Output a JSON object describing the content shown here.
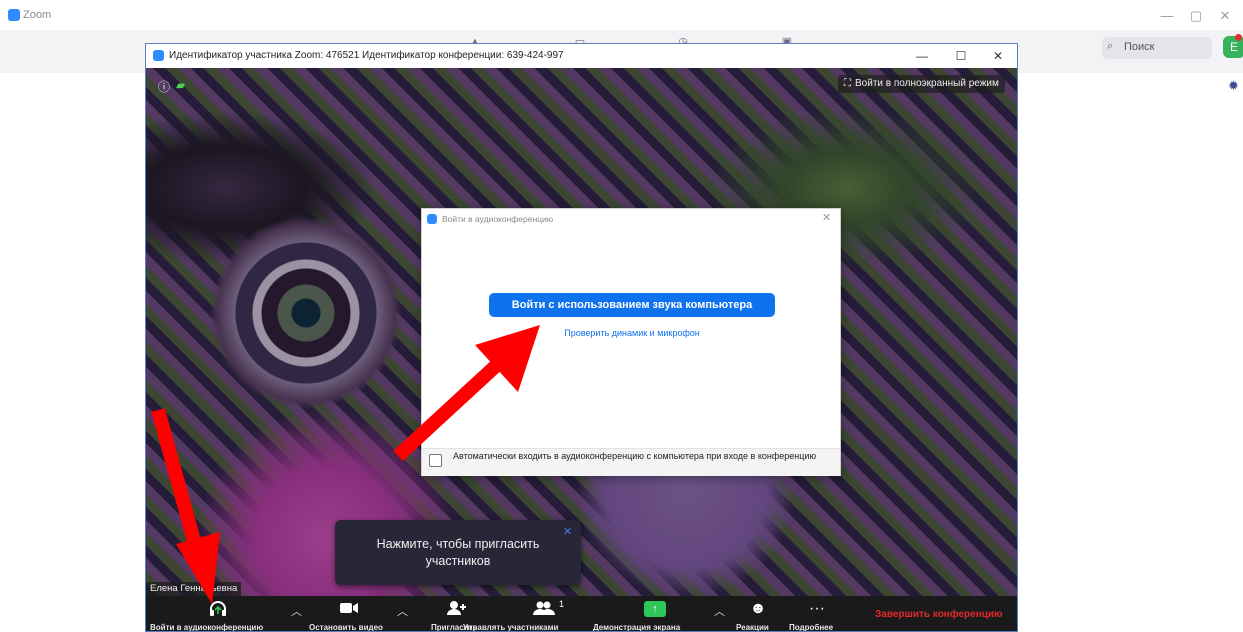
{
  "app": {
    "title": "Zoom",
    "window_controls": {
      "minimize": "—",
      "maximize": "▢",
      "close": "✕"
    },
    "search": {
      "placeholder": "Поиск"
    },
    "profile_initial": "Е"
  },
  "meeting": {
    "window_title": "Идентификатор участника Zoom: 476521   Идентификатор конференции: 639-424-997",
    "window_controls": {
      "minimize": "—",
      "maximize": "☐",
      "close": "✕"
    },
    "fullscreen_label": "Войти в полноэкранный режим",
    "participant_name": "Елена Геннадьевна",
    "invite_tip": "Нажмите, чтобы пригласить участников"
  },
  "toolbar": {
    "join_audio": "Войти в аудиоконференцию",
    "stop_video": "Остановить видео",
    "invite": "Пригласить",
    "manage_participants": "Управлять участниками",
    "participants_count": "1",
    "share_screen": "Демонстрация экрана",
    "reactions": "Реакции",
    "more": "Подробнее",
    "end_meeting": "Завершить конференцию"
  },
  "audio_dialog": {
    "title": "Войти в аудиоконференцию",
    "join_button": "Войти с использованием звука компьютера",
    "test_link": "Проверить динамик и микрофон",
    "auto_join_label": "Автоматически входить в аудиоконференцию с компьютера при входе в конференцию",
    "auto_join_checked": false
  },
  "colors": {
    "brand": "#2d8cff",
    "button": "#0e72ed",
    "end": "#e02a2a",
    "annotation_arrow": "#ff0000"
  }
}
